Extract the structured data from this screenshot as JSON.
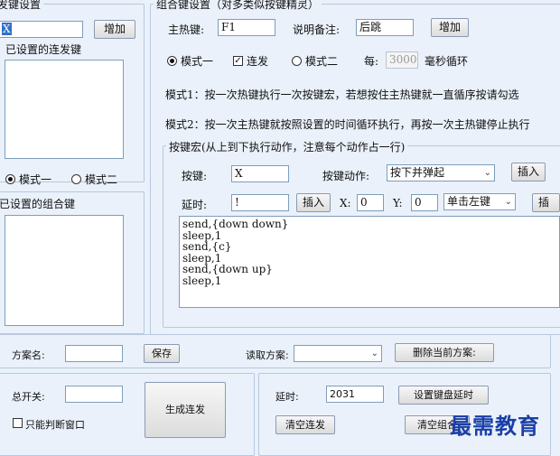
{
  "left_panel": {
    "group_title": "连发键设置",
    "key_input_value": "X",
    "add_button": "增加",
    "set_keys_label": "已设置的连发键",
    "mode1_label": "模式一",
    "mode2_label": "模式二",
    "combo_keys_label": "已设置的组合键"
  },
  "combo_panel": {
    "group_title": "组合键设置（对多类似按键精灵）",
    "hotkey_label": "主热键:",
    "hotkey_value": "F1",
    "note_label": "说明备注:",
    "note_value": "后跳",
    "add_button": "增加",
    "mode1_label": "模式一",
    "repeat_label": "连发",
    "mode2_label": "模式二",
    "interval_label": "每:",
    "interval_value": "3000",
    "interval_unit": "毫秒循环",
    "mode1_desc": "模式1：按一次热键执行一次按键宏，若想按住主热键就一直循序按请勾选",
    "mode2_desc": "模式2：按一次主热键就按照设置的时间循环执行，再按一次主热键停止执行"
  },
  "macro_panel": {
    "group_title": "按键宏(从上到下执行动作，注意每个动作占一行)",
    "key_label": "按键:",
    "key_value": "X",
    "action_label": "按键动作:",
    "action_value": "按下并弹起",
    "insert_button": "插入",
    "delay_label": "延时:",
    "delay_value": "!",
    "insert_button2": "插入",
    "x_label": "X:",
    "x_value": "0",
    "y_label": "Y:",
    "y_value": "0",
    "click_value": "单击左键",
    "insert_button3": "插",
    "script_text": "send,{down down}\nsleep,1\nsend,{c}\nsleep,1\nsend,{down up}\nsleep,1"
  },
  "scheme_bar": {
    "name_label": "方案名:",
    "name_value": "",
    "save_button": "保存",
    "load_label": "读取方案:",
    "delete_button": "删除当前方案:"
  },
  "bottom_bar": {
    "master_switch_label": "总开关:",
    "master_switch_value": "",
    "only_window_label": "只能判断窗口",
    "generate_button": "生成连发",
    "delay_label": "延时:",
    "delay_value": "2031",
    "set_key_delay_button": "设置键盘延时",
    "clear_repeat_button": "清空连发",
    "clear_combo_button": "清空组合"
  },
  "watermark_text": "最需教育"
}
